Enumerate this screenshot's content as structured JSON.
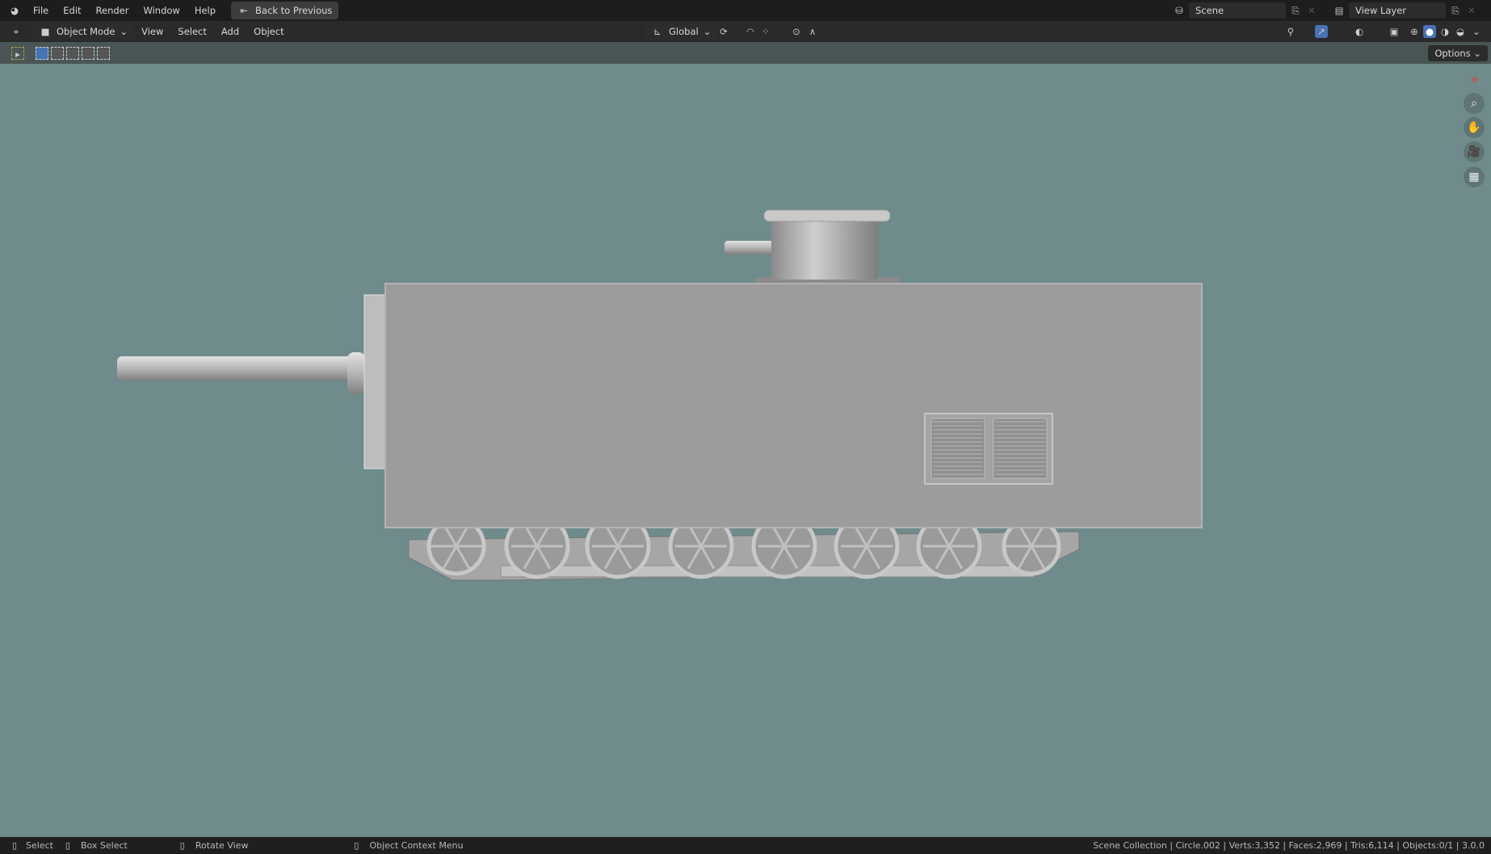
{
  "topbar": {
    "menus": [
      "File",
      "Edit",
      "Render",
      "Window",
      "Help"
    ],
    "back_button": "Back to Previous",
    "scene": "Scene",
    "view_layer": "View Layer"
  },
  "header": {
    "mode": "Object Mode",
    "menus": [
      "View",
      "Select",
      "Add",
      "Object"
    ],
    "orientation": "Global"
  },
  "toolbar": {
    "options": "Options"
  },
  "status": {
    "select": "Select",
    "box_select": "Box Select",
    "rotate": "Rotate View",
    "context": "Object Context Menu",
    "stats": "Scene Collection | Circle.002 | Verts:3,352 | Faces:2,969 | Tris:6,114 | Objects:0/1 | 3.0.0"
  },
  "colors": {
    "viewport": "#6f8b8b",
    "accent": "#4772b3"
  }
}
